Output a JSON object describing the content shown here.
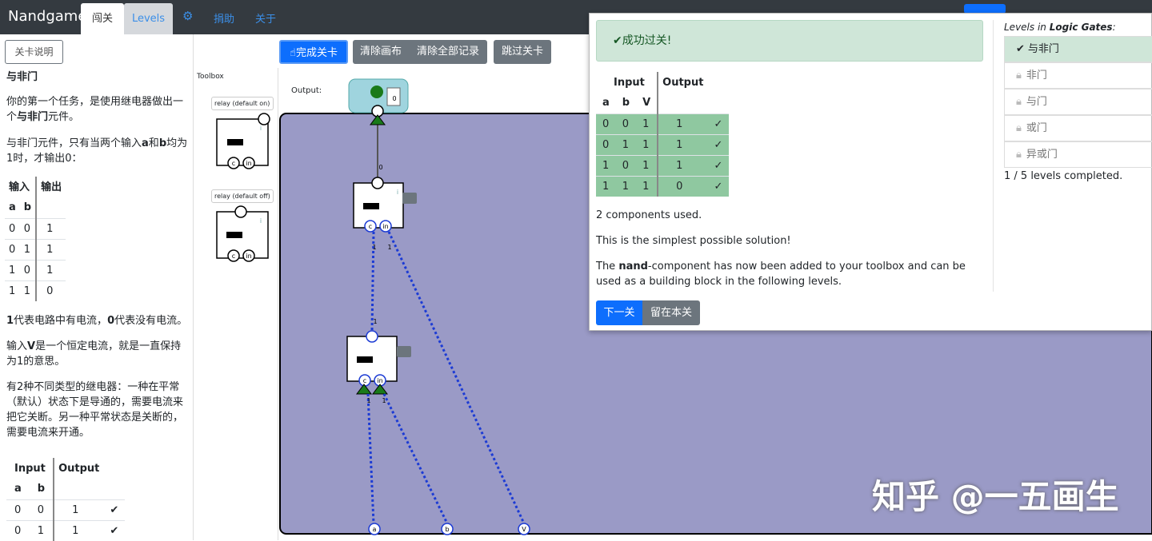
{
  "nav": {
    "brand": "Nandgame",
    "tabs": [
      "闯关",
      "Levels"
    ],
    "gear": "⚙",
    "links": [
      "捐助",
      "关于"
    ],
    "hidden_btn": "......"
  },
  "sidebar": {
    "button": "关卡说明",
    "title": "与非门",
    "p1a": "你的第一个任务，是使用继电器做出一个",
    "p1b": "与非门",
    "p1c": "元件。",
    "p2a": "与非门元件，只有当两个输入",
    "p2b": "a",
    "p2c": "和",
    "p2d": "b",
    "p2e": "均为1时，才输出0：",
    "t1_headers": [
      "输入",
      "输出"
    ],
    "t1_sub": [
      "a",
      "b"
    ],
    "t1_rows": [
      [
        "0",
        "0",
        "1"
      ],
      [
        "0",
        "1",
        "1"
      ],
      [
        "1",
        "0",
        "1"
      ],
      [
        "1",
        "1",
        "0"
      ]
    ],
    "p3a": "1",
    "p3b": "代表电路中有电流，",
    "p3c": "0",
    "p3d": "代表没有电流。",
    "p4a": "输入",
    "p4b": "V",
    "p4c": "是一个恒定电流，就是一直保持为1的意思。",
    "p5": "有2种不同类型的继电器：一种在平常（默认）状态下是导通的，需要电流来把它关断。另一种平常状态是关断的，需要电流来开通。",
    "t2_headers": [
      "Input",
      "Output"
    ],
    "t2_sub": [
      "a",
      "b"
    ],
    "t2_rows": [
      [
        "0",
        "0",
        "1",
        "✔"
      ],
      [
        "0",
        "1",
        "1",
        "✔"
      ]
    ]
  },
  "work": {
    "buttons": [
      "完成关卡",
      "清除画布",
      "清除全部记录",
      "跳过关卡"
    ],
    "toolbox": "Toolbox",
    "relay_on": "relay (default on)",
    "relay_off": "relay (default off)",
    "output_label": "Output:",
    "output_value": "0",
    "pins": {
      "c": "c",
      "in": "in",
      "a": "a",
      "b": "b",
      "V": "V",
      "one": "1",
      "zero": "0",
      "i": "i"
    }
  },
  "dialog": {
    "success": "成功过关!",
    "table_headers": [
      "Input",
      "Output"
    ],
    "table_sub": [
      "a",
      "b",
      "V"
    ],
    "table_rows": [
      [
        "0",
        "0",
        "1",
        "1",
        "✓"
      ],
      [
        "0",
        "1",
        "1",
        "1",
        "✓"
      ],
      [
        "1",
        "0",
        "1",
        "1",
        "✓"
      ],
      [
        "1",
        "1",
        "1",
        "0",
        "✓"
      ]
    ],
    "p1": "2 components used.",
    "p2": "This is the simplest possible solution!",
    "p3a": "The ",
    "p3b": "nand",
    "p3c": "-component has now been added to your toolbox and can be used as a building block in the following levels.",
    "next": "下一关",
    "stay": "留在本关",
    "levels_title_a": "Levels in ",
    "levels_title_b": "Logic Gates",
    "levels_title_c": ":",
    "levels": [
      "与非门",
      "非门",
      "与门",
      "或门",
      "异或门"
    ],
    "completed": "1 / 5 levels completed."
  },
  "watermark": "知乎 @一五画生"
}
